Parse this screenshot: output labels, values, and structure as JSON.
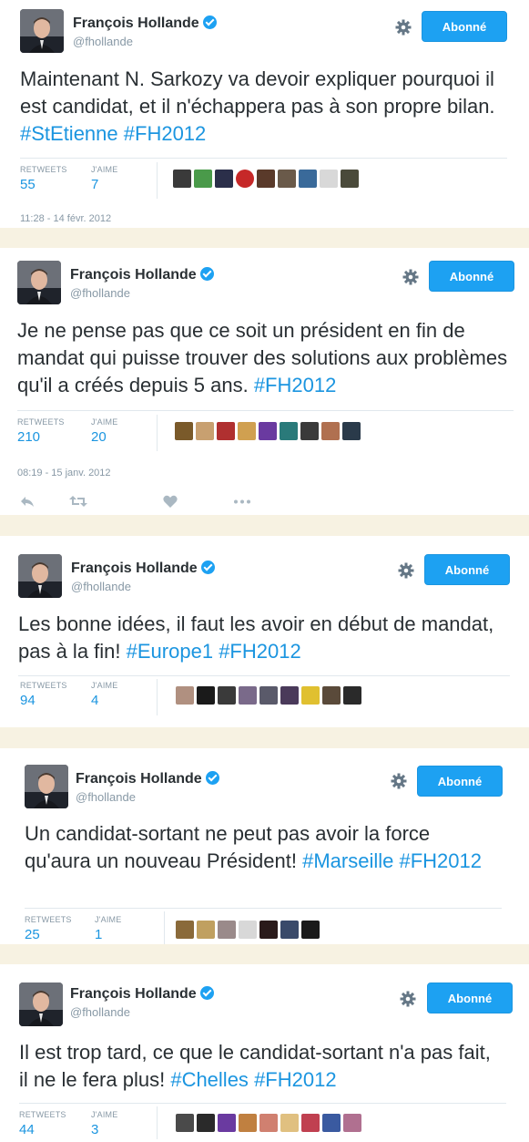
{
  "author": {
    "name": "François Hollande",
    "handle": "@fhollande"
  },
  "follow_label": "Abonné",
  "stats_labels": {
    "retweets": "RETWEETS",
    "likes": "J'AIME"
  },
  "tweets": [
    {
      "text_plain": "Maintenant N. Sarkozy va devoir expliquer pourquoi il est candidat, et il n'échappera pas à son propre bilan.",
      "hashtags": [
        "#StEtienne",
        "#FH2012"
      ],
      "retweets": "55",
      "likes": "7",
      "timestamp": "11:28 - 14 févr. 2012"
    },
    {
      "text_plain": "Je ne pense pas que ce soit un président en fin de mandat qui puisse trouver des solutions aux problèmes qu'il a créés depuis 5 ans.",
      "hashtags": [
        "#FH2012"
      ],
      "retweets": "210",
      "likes": "20",
      "timestamp": "08:19 - 15 janv. 2012"
    },
    {
      "text_plain": "Les bonne idées, il faut les avoir en début de mandat, pas à la fin!",
      "hashtags": [
        "#Europe1",
        "#FH2012"
      ],
      "retweets": "94",
      "likes": "4"
    },
    {
      "text_plain": "Un candidat-sortant ne peut pas avoir la force qu'aura un nouveau Président!",
      "hashtags": [
        "#Marseille",
        "#FH2012"
      ],
      "retweets": "25",
      "likes": "1"
    },
    {
      "text_plain": "Il est trop tard, ce que le candidat-sortant n'a pas fait, il ne le fera plus!",
      "hashtags": [
        "#Chelles",
        "#FH2012"
      ],
      "retweets": "44",
      "likes": "3"
    }
  ],
  "colors": {
    "accent": "#1da1f2",
    "link": "#1b95e0",
    "separator": "#f7f2e2",
    "muted": "#8899a6"
  },
  "icons": [
    "verified-badge-icon",
    "gear-icon",
    "reply-icon",
    "retweet-icon",
    "like-icon",
    "more-icon"
  ]
}
